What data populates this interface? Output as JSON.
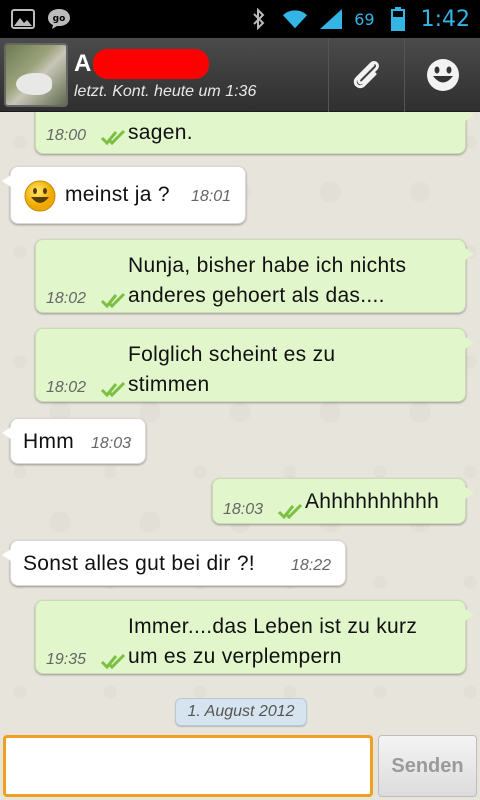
{
  "statusbar": {
    "battery": "69",
    "time": "1:42"
  },
  "header": {
    "contact_initial": "A",
    "last_seen": "letzt. Kont. heute um 1:36"
  },
  "messages": [
    {
      "dir": "out",
      "text": "sagen.",
      "time": "18:00",
      "delivered": true
    },
    {
      "dir": "in",
      "emoji": "smiley",
      "text": "meinst ja ?",
      "time": "18:01"
    },
    {
      "dir": "out",
      "text_lines": [
        "Nunja, bisher habe ich nichts",
        "anderes gehoert als das...."
      ],
      "time": "18:02",
      "delivered": true
    },
    {
      "dir": "out",
      "text_lines": [
        "Folglich scheint es zu",
        "stimmen"
      ],
      "time": "18:02",
      "delivered": true
    },
    {
      "dir": "in",
      "text": "Hmm",
      "time": "18:03"
    },
    {
      "dir": "out",
      "text": "Ahhhhhhhhhh",
      "time": "18:03",
      "delivered": true
    },
    {
      "dir": "in",
      "text": "Sonst alles gut bei dir ?!",
      "time": "18:22"
    },
    {
      "dir": "out",
      "text_lines": [
        "Immer....das Leben ist zu kurz",
        "um es zu verplempern"
      ],
      "time": "19:35",
      "delivered": true
    }
  ],
  "date_separator": "1. August 2012",
  "composer": {
    "value": "",
    "send_label": "Senden"
  },
  "colors": {
    "outgoing_bubble": "#e1f6cb",
    "incoming_bubble": "#ffffff",
    "check": "#7cc043",
    "accent": "#33b5e5",
    "input_focus": "#f0a020"
  }
}
